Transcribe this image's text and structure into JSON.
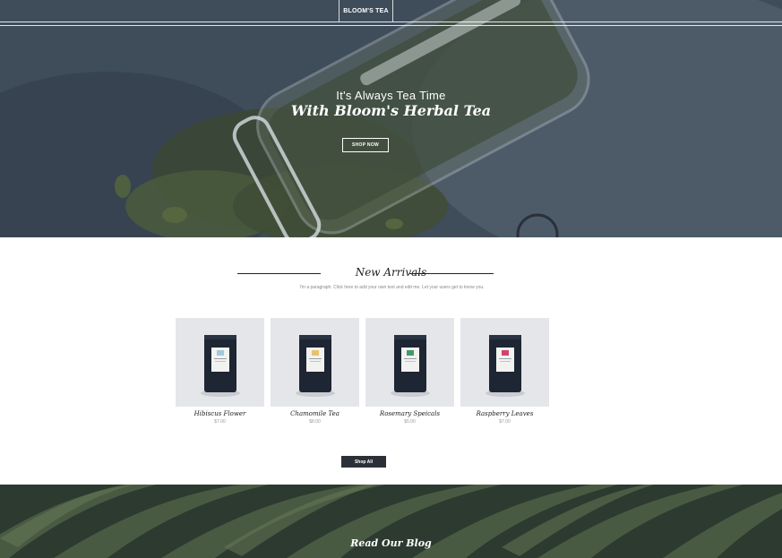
{
  "header": {
    "brand": "BLOOM'S TEA"
  },
  "hero": {
    "subtitle": "It's Always Tea Time",
    "title": "With Bloom's Herbal Tea",
    "cta_label": "SHOP NOW"
  },
  "arrivals": {
    "title": "New Arrivals",
    "paragraph": "I'm a paragraph. Click here to add your own text and edit me. Let your users get to know you.",
    "products": [
      {
        "name": "Hibiscus Flower",
        "price": "$7.00",
        "accent": "#9ec9e0"
      },
      {
        "name": "Chamomile Tea",
        "price": "$8.00",
        "accent": "#e7c26f"
      },
      {
        "name": "Rosemary Speicals",
        "price": "$5.00",
        "accent": "#3f9a6b"
      },
      {
        "name": "Raspberry Leaves",
        "price": "$7.00",
        "accent": "#d2436a"
      }
    ],
    "shop_all_label": "Shop All"
  },
  "blog": {
    "title": "Read Our Blog"
  },
  "colors": {
    "hero_bg": "#3e4a58",
    "button_dark": "#2b3038",
    "blog_bg": "#2f3d33"
  }
}
